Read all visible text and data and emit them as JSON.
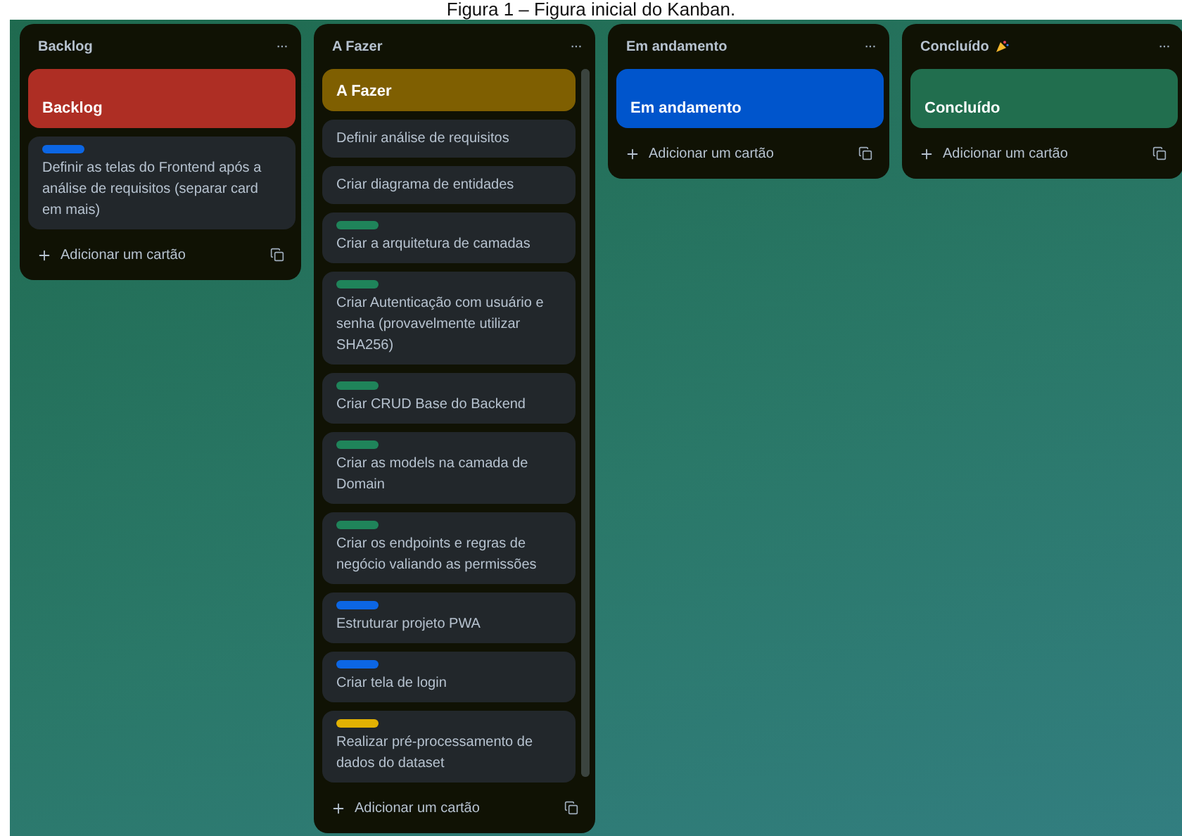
{
  "caption": "Figura 1 – Figura inicial do Kanban.",
  "menu": "···",
  "lists": [
    {
      "title": "Backlog",
      "emoji": false,
      "scroll": false,
      "cards": [
        {
          "kind": "cover",
          "color": "#ae2e24",
          "text": "Backlog"
        },
        {
          "kind": "task",
          "color": "#0c66e4",
          "text": "Definir as telas do Frontend após a análise de requisitos (separar card em mais)"
        }
      ],
      "add": "Adicionar um cartão"
    },
    {
      "title": "A Fazer",
      "emoji": false,
      "scroll": true,
      "cards": [
        {
          "kind": "cover",
          "color": "#7f5f01",
          "text": "A Fazer"
        },
        {
          "kind": "task",
          "text": "Definir análise de requisitos"
        },
        {
          "kind": "task",
          "text": "Criar diagrama de entidades"
        },
        {
          "kind": "task",
          "color": "#1f845a",
          "text": "Criar a arquitetura de camadas"
        },
        {
          "kind": "task",
          "color": "#1f845a",
          "text": "Criar Autenticação com usuário e senha (provavelmente utilizar SHA256)"
        },
        {
          "kind": "task",
          "color": "#1f845a",
          "text": "Criar CRUD Base do Backend"
        },
        {
          "kind": "task",
          "color": "#1f845a",
          "text": "Criar as models na camada de Domain"
        },
        {
          "kind": "task",
          "color": "#1f845a",
          "text": "Criar os endpoints e regras de negócio valiando as permissões"
        },
        {
          "kind": "task",
          "color": "#0c66e4",
          "text": "Estruturar projeto PWA"
        },
        {
          "kind": "task",
          "color": "#0c66e4",
          "text": "Criar tela de login"
        },
        {
          "kind": "task",
          "color": "#e2b203",
          "text": "Realizar pré-processamento de dados do dataset"
        }
      ],
      "add": "Adicionar um cartão"
    },
    {
      "title": "Em andamento",
      "emoji": false,
      "scroll": false,
      "cards": [
        {
          "kind": "cover",
          "color": "#0055cc",
          "text": "Em andamento"
        }
      ],
      "add": "Adicionar um cartão"
    },
    {
      "title": "Concluído",
      "emoji": true,
      "scroll": false,
      "cards": [
        {
          "kind": "cover",
          "color": "#216e4e",
          "text": "Concluído"
        }
      ],
      "add": "Adicionar um cartão"
    }
  ]
}
